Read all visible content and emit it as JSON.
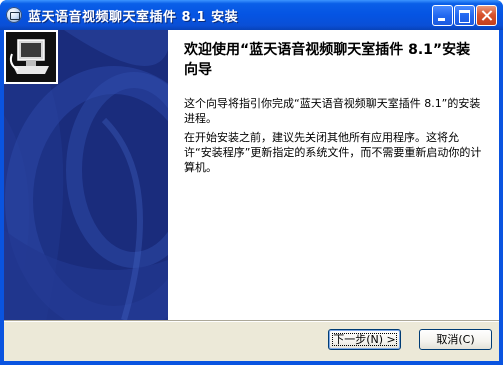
{
  "window": {
    "title": "蓝天语音视频聊天室插件 8.1 安装"
  },
  "content": {
    "heading": "欢迎使用“蓝天语音视频聊天室插件 8.1”安装向导",
    "paragraph1": "这个向导将指引你完成“蓝天语音视频聊天室插件 8.1”的安装进程。",
    "paragraph2": "在开始安装之前，建议先关闭其他所有应用程序。这将允许“安装程序”更新指定的系统文件，而不需要重新启动你的计算机。"
  },
  "buttons": {
    "next": "下一步(N) >",
    "cancel": "取消(C)"
  },
  "icons": {
    "window": "app-icon",
    "installer": "installer-computer-icon",
    "minimize": "minimize-icon",
    "maximize": "maximize-icon",
    "close": "close-icon"
  },
  "colors": {
    "titlebar": "#0554e3",
    "sidebar": "#1c2f7e",
    "dialog_face": "#ece9d8"
  }
}
